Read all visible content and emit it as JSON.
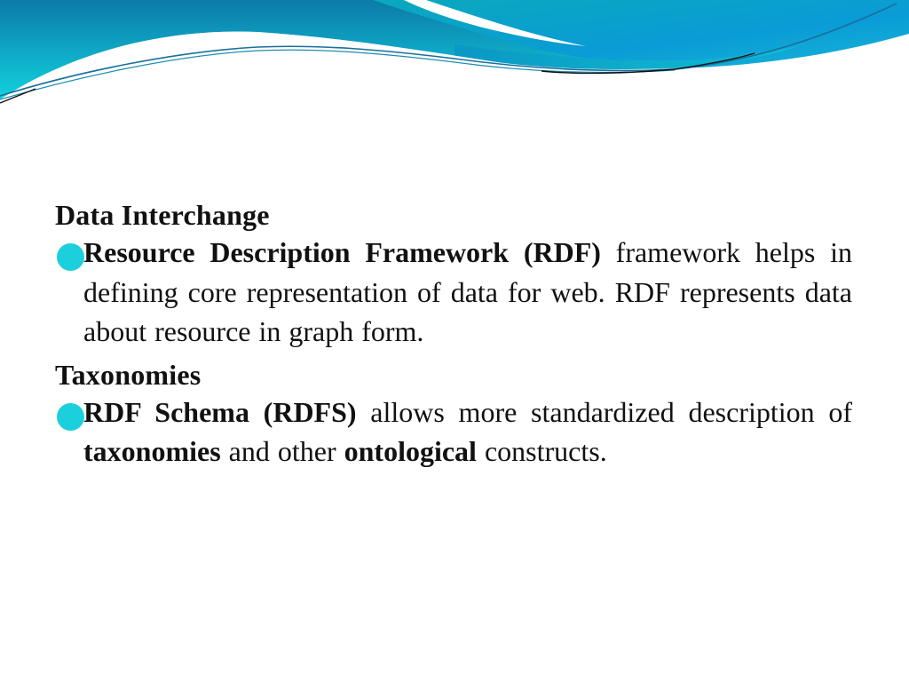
{
  "slide": {
    "theme_colors": {
      "wave_dark": "#0f7fae",
      "wave_mid": "#0aa0c8",
      "wave_light": "#15d3e0",
      "bullet": "#1ccfdc",
      "text": "#111111"
    },
    "sections": [
      {
        "heading": "Data Interchange",
        "bullet": {
          "segments": [
            {
              "text": "Resource Description Framework (RDF)",
              "bold": true
            },
            {
              "text": " framework helps in defining core representation of data for web. RDF represents data about resource in graph form.",
              "bold": false
            }
          ]
        }
      },
      {
        "heading": "Taxonomies",
        "bullet": {
          "segments": [
            {
              "text": "RDF Schema (RDFS)",
              "bold": true
            },
            {
              "text": " allows more standardized description of ",
              "bold": false
            },
            {
              "text": "taxonomies",
              "bold": true
            },
            {
              "text": " and other ",
              "bold": false
            },
            {
              "text": "ontological",
              "bold": true
            },
            {
              "text": " constructs.",
              "bold": false
            }
          ]
        }
      }
    ]
  }
}
